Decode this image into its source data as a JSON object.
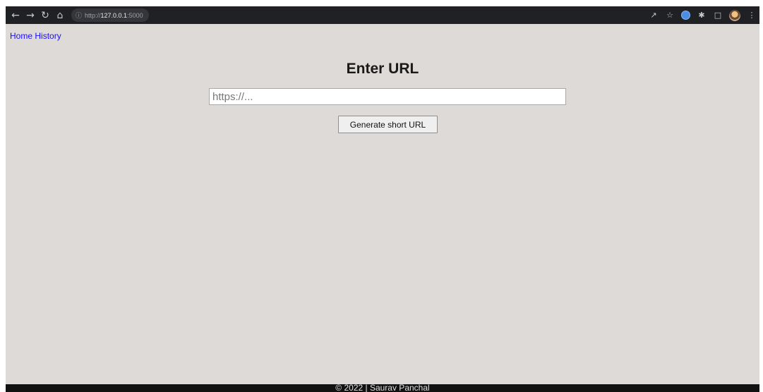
{
  "browser": {
    "url_scheme": "http://",
    "url_host": "127.0.0.1",
    "url_port": ":5000",
    "nav_icons": [
      "back-arrow-icon",
      "forward-arrow-icon",
      "reload-icon",
      "home-icon"
    ],
    "right_icons": [
      "share-icon",
      "star-icon",
      "extension-icon",
      "puzzle-icon",
      "sidepanel-icon",
      "profile-avatar",
      "menu-icon"
    ]
  },
  "nav": {
    "home": "Home",
    "history": "History"
  },
  "main": {
    "title": "Enter URL",
    "url_placeholder": "https://...",
    "url_value": "",
    "generate_label": "Generate short URL"
  },
  "footer": {
    "text": "© 2022 | Saurav Panchal"
  },
  "colors": {
    "page_bg": "#dedad7",
    "link": "#1a0dff",
    "toolbar": "#202124"
  }
}
